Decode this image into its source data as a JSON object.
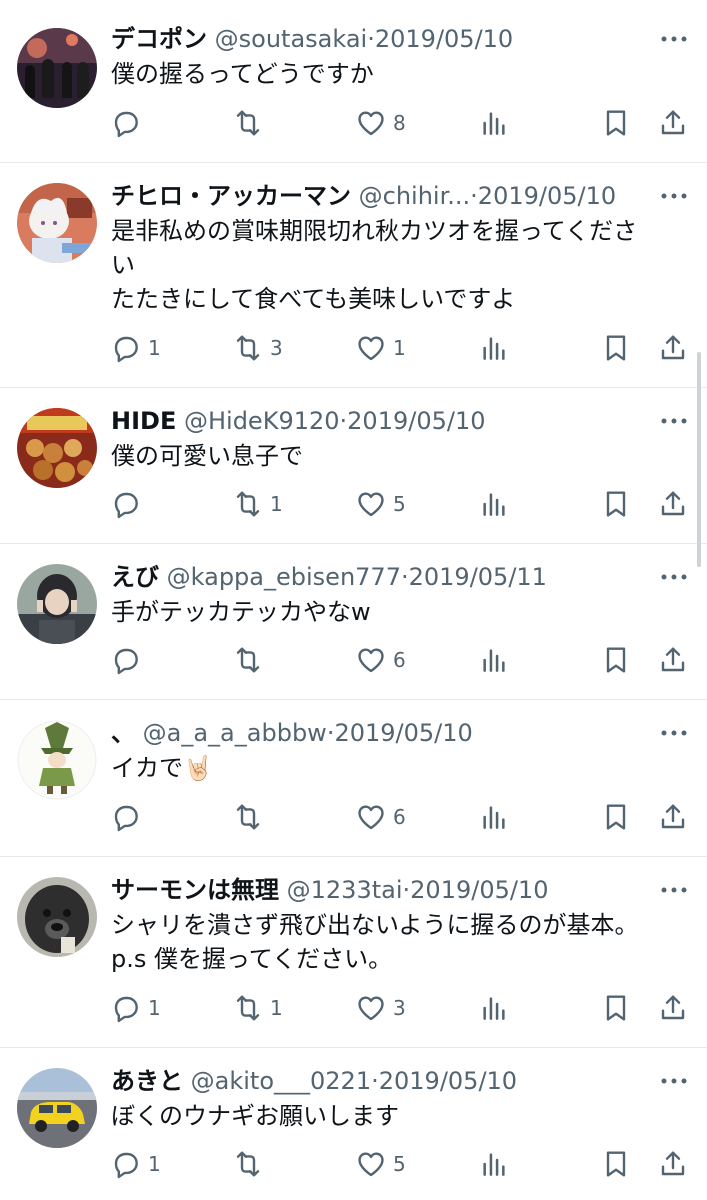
{
  "colors": {
    "text": "#0f1419",
    "secondary": "#536471",
    "divider": "#e7e9ec",
    "background": "#ffffff"
  },
  "tweets": [
    {
      "name": "デコポン",
      "handle": "@soutasakai",
      "date": "2019/05/10",
      "text": "僕の握るってどうですか",
      "reply": "",
      "retweet": "",
      "like": "8",
      "avatar": "concert-crowd-photo"
    },
    {
      "name": "チヒロ・アッカーマン",
      "handle": "@chihir...",
      "date": "2019/05/10",
      "text": "是非私めの賞味期限切れ秋カツオを握ってくださ\nい\nたたきにして食べても美味しいですよ",
      "reply": "1",
      "retweet": "3",
      "like": "1",
      "avatar": "anime-character-illustration"
    },
    {
      "name": "HIDE",
      "handle": "@HideK9120",
      "date": "2019/05/10",
      "text": "僕の可愛い息子で",
      "reply": "",
      "retweet": "1",
      "like": "5",
      "avatar": "snack-bag-photo"
    },
    {
      "name": "えび",
      "handle": "@kappa_ebisen777",
      "date": "2019/05/11",
      "text": "手がテッカテッカやなw",
      "reply": "",
      "retweet": "",
      "like": "6",
      "avatar": "person-peace-sign-photo"
    },
    {
      "name": "、",
      "handle": "@a_a_a_abbbw",
      "date": "2019/05/10",
      "text": "イカで🤘🏻",
      "reply": "",
      "retweet": "",
      "like": "6",
      "avatar": "snufkin-illustration"
    },
    {
      "name": "サーモンは無理",
      "handle": "@1233tai",
      "date": "2019/05/10",
      "text": "シャリを潰さず飛び出ないように握るのが基本。\np.s 僕を握ってください。",
      "reply": "1",
      "retweet": "1",
      "like": "3",
      "avatar": "poodle-dog-photo"
    },
    {
      "name": "あきと",
      "handle": "@akito___0221",
      "date": "2019/05/10",
      "text": "ぼくのウナギお願いします",
      "reply": "1",
      "retweet": "",
      "like": "5",
      "avatar": "yellow-car-photo"
    }
  ],
  "icons": {
    "reply": "reply-icon",
    "retweet": "retweet-icon",
    "like": "heart-icon",
    "views": "views-icon",
    "bookmark": "bookmark-icon",
    "share": "share-icon",
    "more": "more-icon"
  },
  "separator": "·"
}
